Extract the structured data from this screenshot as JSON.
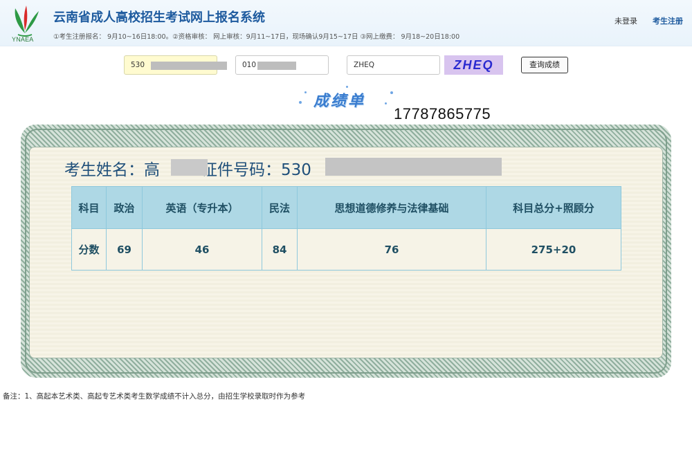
{
  "header": {
    "title": "云南省成人高校招生考试网上报名系统",
    "subtitle": "①考生注册报名： 9月10~16日18:00。②资格审核： 网上审核：9月11~17日，现场确认9月15~17日 ③网上缴费： 9月18~20日18:00",
    "logo_text": "YNAEA",
    "nav": {
      "login": "未登录",
      "register": "考生注册"
    }
  },
  "query": {
    "id_value": "530",
    "cert_value": "010",
    "code_value": "ZHEQ",
    "captcha": "ZHEQ",
    "button": "查询成绩"
  },
  "sheet": {
    "title": "成绩单",
    "phone": "17787865775",
    "name_label": "考生姓名：高",
    "cert_label": "证件号码：530"
  },
  "table": {
    "head": [
      "科目",
      "政治",
      "英语（专升本）",
      "民法",
      "思想道德修养与法律基础",
      "科目总分+照顾分"
    ],
    "vals": [
      "分数",
      "69",
      "46",
      "84",
      "76",
      "275+20"
    ]
  },
  "footnote": "备注：1、高起本艺术类、高起专艺术类考生数学成绩不计入总分，由招生学校录取时作为参考",
  "colors": {
    "brand": "#1d5a9e",
    "table_head": "#aed8e5",
    "captcha_bg": "#d8c4ef"
  }
}
